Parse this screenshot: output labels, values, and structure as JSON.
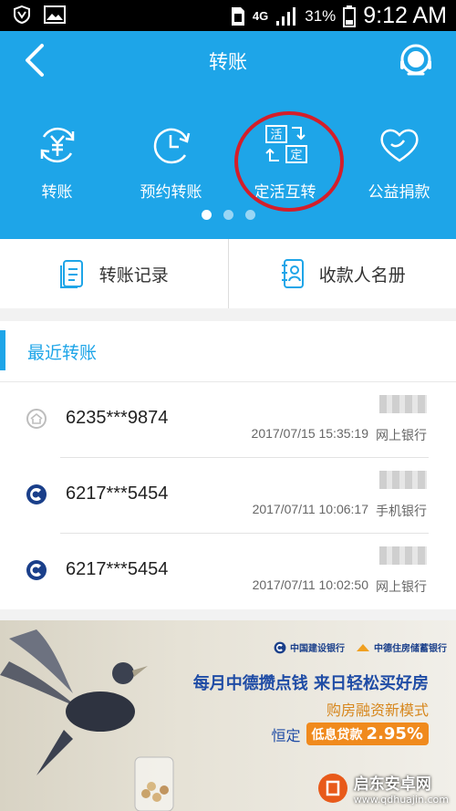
{
  "status_bar": {
    "network": "4G",
    "battery": "31%",
    "time": "9:12 AM"
  },
  "header": {
    "title": "转账",
    "quick_actions": [
      {
        "label": "转账",
        "icon": "yuan-transfer-icon"
      },
      {
        "label": "预约转账",
        "icon": "clock-icon"
      },
      {
        "label": "定活互转",
        "icon": "deposit-swap-icon",
        "icon_text": [
          "活",
          "定"
        ]
      },
      {
        "label": "公益捐款",
        "icon": "heart-icon"
      }
    ],
    "pager": {
      "pages": 3,
      "active": 1
    }
  },
  "links": {
    "records": "转账记录",
    "payees": "收款人名册"
  },
  "recent": {
    "title": "最近转账",
    "items": [
      {
        "account": "6235***9874",
        "datetime": "2017/07/15 15:35:19",
        "channel": "网上银行",
        "bank_icon": "generic-bank-icon"
      },
      {
        "account": "6217***5454",
        "datetime": "2017/07/11 10:06:17",
        "channel": "手机银行",
        "bank_icon": "ccb-icon"
      },
      {
        "account": "6217***5454",
        "datetime": "2017/07/11 10:02:50",
        "channel": "网上银行",
        "bank_icon": "ccb-icon"
      }
    ]
  },
  "banner": {
    "bank1": "中国建设银行",
    "bank2": "中德住房储蓄银行",
    "slogan": "每月中德攒点钱 来日轻松买好房",
    "subtitle": "购房融资新模式",
    "rate_prefix": "恒定",
    "rate_label": "低息贷款",
    "rate_value": "2.95%"
  },
  "watermark": {
    "name": "启东安卓网",
    "url": "www.qdhuajin.com"
  },
  "colors": {
    "primary": "#1ea5e8",
    "highlight_circle": "#d41e2a",
    "ccb_blue": "#1a3f8a"
  }
}
